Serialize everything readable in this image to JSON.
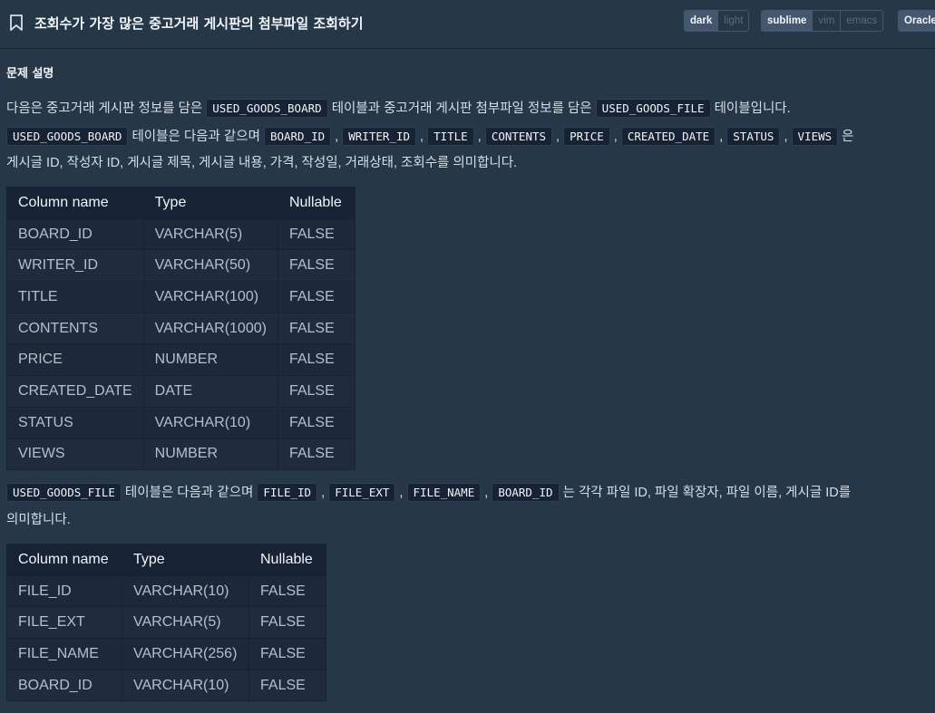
{
  "header": {
    "title": "조회수가 가장 많은 중고거래 게시판의 첨부파일 조회하기",
    "theme_options": [
      "dark",
      "light"
    ],
    "theme_selected": "dark",
    "keymap_options": [
      "sublime",
      "vim",
      "emacs"
    ],
    "keymap_selected": "sublime",
    "language": "Oracle"
  },
  "section": {
    "title": "문제 설명"
  },
  "para1": {
    "t1": "다음은 중고거래 게시판 정보를 담은 ",
    "c1": "USED_GOODS_BOARD",
    "t2": " 테이블과 중고거래 게시판 첨부파일 정보를 담은 ",
    "c2": "USED_GOODS_FILE",
    "t3": " 테이블입니다."
  },
  "para2": {
    "c0": "USED_GOODS_BOARD",
    "t0": " 테이블은 다음과 같으며 ",
    "cols": [
      "BOARD_ID",
      "WRITER_ID",
      "TITLE",
      "CONTENTS",
      "PRICE",
      "CREATED_DATE",
      "STATUS",
      "VIEWS"
    ],
    "sep": " , ",
    "t1": " 은",
    "t2": "게시글 ID, 작성자 ID, 게시글 제목, 게시글 내용, 가격, 작성일, 거래상태, 조회수를 의미합니다."
  },
  "table_board": {
    "headers": [
      "Column name",
      "Type",
      "Nullable"
    ],
    "rows": [
      [
        "BOARD_ID",
        "VARCHAR(5)",
        "FALSE"
      ],
      [
        "WRITER_ID",
        "VARCHAR(50)",
        "FALSE"
      ],
      [
        "TITLE",
        "VARCHAR(100)",
        "FALSE"
      ],
      [
        "CONTENTS",
        "VARCHAR(1000)",
        "FALSE"
      ],
      [
        "PRICE",
        "NUMBER",
        "FALSE"
      ],
      [
        "CREATED_DATE",
        "DATE",
        "FALSE"
      ],
      [
        "STATUS",
        "VARCHAR(10)",
        "FALSE"
      ],
      [
        "VIEWS",
        "NUMBER",
        "FALSE"
      ]
    ]
  },
  "para3": {
    "c0": "USED_GOODS_FILE",
    "t0": " 테이블은 다음과 같으며 ",
    "cols": [
      "FILE_ID",
      "FILE_EXT",
      "FILE_NAME",
      "BOARD_ID"
    ],
    "sep": " , ",
    "t1": " 는 각각 파일 ID, 파일 확장자, 파일 이름, 게시글 ID를",
    "t2": "의미합니다."
  },
  "table_file": {
    "headers": [
      "Column name",
      "Type",
      "Nullable"
    ],
    "rows": [
      [
        "FILE_ID",
        "VARCHAR(10)",
        "FALSE"
      ],
      [
        "FILE_EXT",
        "VARCHAR(5)",
        "FALSE"
      ],
      [
        "FILE_NAME",
        "VARCHAR(256)",
        "FALSE"
      ],
      [
        "BOARD_ID",
        "VARCHAR(10)",
        "FALSE"
      ]
    ]
  },
  "icons": {
    "bookmark": "bookmark-icon"
  },
  "colors": {
    "background": "#263747",
    "code_bg": "#172334",
    "table_header_bg": "#172334",
    "text": "#d5dfe8"
  }
}
